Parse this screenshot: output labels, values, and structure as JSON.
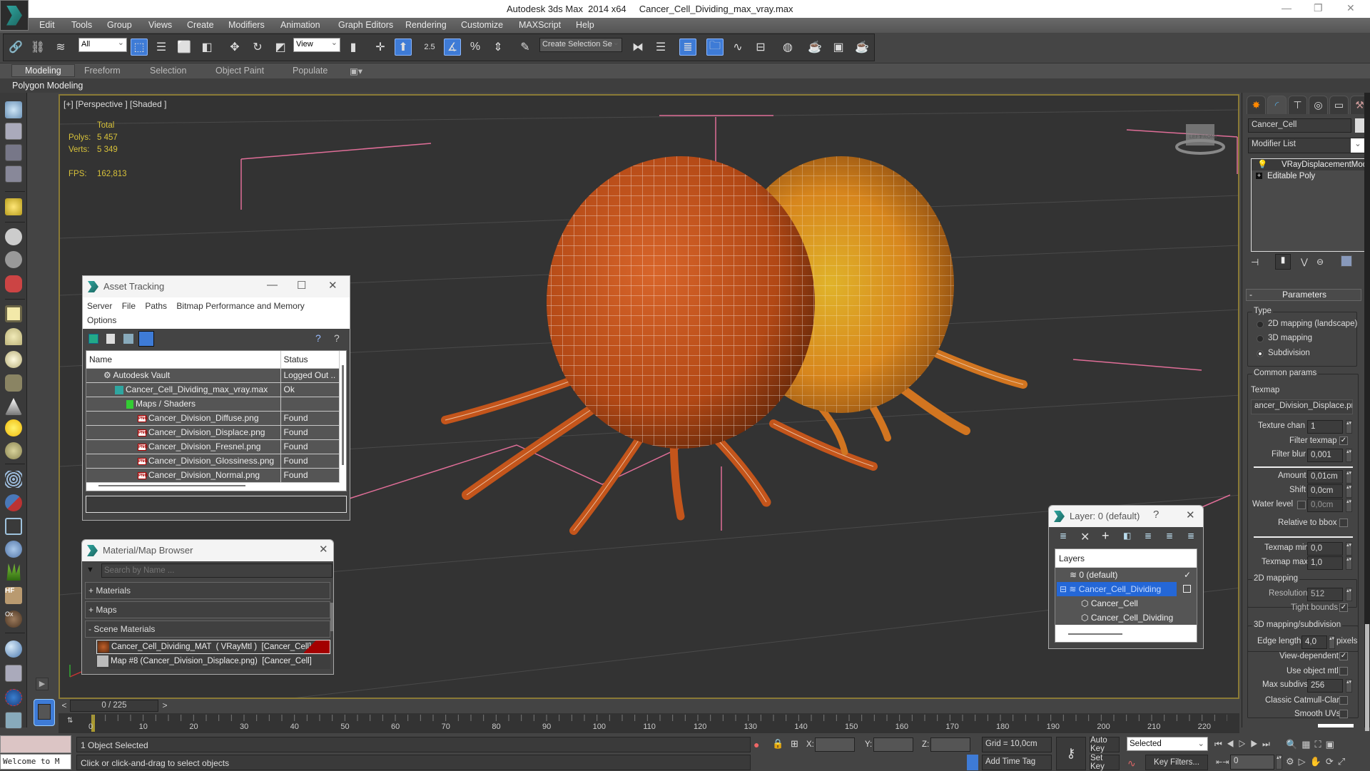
{
  "window": {
    "title": "Autodesk 3ds Max  2014 x64     Cancer_Cell_Dividing_max_vray.max",
    "minimize": "—",
    "maximize": "❐",
    "close": "✕"
  },
  "menu": [
    "Edit",
    "Tools",
    "Group",
    "Views",
    "Create",
    "Modifiers",
    "Animation",
    "Graph Editors",
    "Rendering",
    "Customize",
    "MAXScript",
    "Help"
  ],
  "toolbar": {
    "selection_filter": "All",
    "ref_coord": "View",
    "snap_value": "2.5",
    "named_selection_placeholder": "Create Selection Se"
  },
  "ribbon": {
    "tabs": [
      "Modeling",
      "Freeform",
      "Selection",
      "Object Paint",
      "Populate"
    ],
    "active": "Modeling",
    "subpanel": "Polygon Modeling"
  },
  "viewport": {
    "label": "[+] [Perspective ] [Shaded ]",
    "stats": {
      "header": "Total",
      "polys_label": "Polys:",
      "polys": "5 457",
      "verts_label": "Verts:",
      "verts": "5 349",
      "fps_label": "FPS:",
      "fps": "162,813"
    },
    "viewcube": {
      "left": "LEFT",
      "front": "FRONT"
    }
  },
  "asset_tracking": {
    "title": "Asset Tracking",
    "menu": [
      "Server",
      "File",
      "Paths",
      "Bitmap Performance and Memory",
      "Options"
    ],
    "columns": [
      "Name",
      "Status"
    ],
    "rows": [
      {
        "name": "Autodesk Vault",
        "status": "Logged Out ..",
        "icon": "vault-icon",
        "indent": 1
      },
      {
        "name": "Cancer_Cell_Dividing_max_vray.max",
        "status": "Ok",
        "icon": "max-file-icon",
        "indent": 2
      },
      {
        "name": "Maps / Shaders",
        "status": "",
        "icon": "maps-folder-icon",
        "indent": 3
      },
      {
        "name": "Cancer_Division_Diffuse.png",
        "status": "Found",
        "icon": "png-icon",
        "indent": 4
      },
      {
        "name": "Cancer_Division_Displace.png",
        "status": "Found",
        "icon": "png-icon",
        "indent": 4
      },
      {
        "name": "Cancer_Division_Fresnel.png",
        "status": "Found",
        "icon": "png-icon",
        "indent": 4
      },
      {
        "name": "Cancer_Division_Glossiness.png",
        "status": "Found",
        "icon": "png-icon",
        "indent": 4
      },
      {
        "name": "Cancer_Division_Normal.png",
        "status": "Found",
        "icon": "png-icon",
        "indent": 4
      }
    ],
    "png_glyph": "PNG"
  },
  "material_browser": {
    "title": "Material/Map Browser",
    "search_placeholder": "Search by Name ...",
    "groups": [
      "+ Materials",
      "+ Maps",
      "- Scene Materials"
    ],
    "items": [
      "Cancer_Cell_Dividing_MAT  ( VRayMtl )  [Cancer_Cell]",
      "Map #8 (Cancer_Division_Displace.png)  [Cancer_Cell]"
    ]
  },
  "layer_dialog": {
    "title": "Layer: 0 (default)",
    "help": "?",
    "column": "Layers",
    "rows": [
      {
        "name": "0 (default)",
        "type": "layer",
        "state": "✓"
      },
      {
        "name": "Cancer_Cell_Dividing",
        "type": "layer",
        "state": "",
        "selected": true
      },
      {
        "name": "Cancer_Cell",
        "type": "object"
      },
      {
        "name": "Cancer_Cell_Dividing",
        "type": "object"
      }
    ]
  },
  "command_panel": {
    "object_name": "Cancer_Cell",
    "modifier_list": "Modifier List",
    "stack": [
      "VRayDisplacementMod",
      "Editable Poly"
    ],
    "rollout_title": "Parameters",
    "type_group": "Type",
    "type_options": [
      "2D mapping (landscape)",
      "3D mapping",
      "Subdivision"
    ],
    "type_selected": 2,
    "common_group": "Common params",
    "texmap_label": "Texmap",
    "texmap_value": "ancer_Division_Displace.png)",
    "texture_chan_label": "Texture chan",
    "texture_chan": "1",
    "filter_texmap_label": "Filter texmap",
    "filter_texmap": true,
    "filter_blur_label": "Filter blur",
    "filter_blur": "0,001",
    "amount_label": "Amount",
    "amount": "0,01cm",
    "shift_label": "Shift",
    "shift": "0,0cm",
    "water_level_label": "Water level",
    "water_level": "0,0cm",
    "relative_bbox_label": "Relative to bbox",
    "texmap_min_label": "Texmap min",
    "texmap_min": "0,0",
    "texmap_max_label": "Texmap max",
    "texmap_max": "1,0",
    "mapping2d_group": "2D mapping",
    "resolution_label": "Resolution",
    "resolution": "512",
    "tight_bounds_label": "Tight bounds",
    "tight_bounds": true,
    "mapping3d_group": "3D mapping/subdivision",
    "edge_length_label": "Edge length",
    "edge_length": "4,0",
    "pixels_label": "pixels",
    "view_dependent_label": "View-dependent",
    "view_dependent": true,
    "use_object_mtl_label": "Use object mtl",
    "max_subdivs_label": "Max subdivs",
    "max_subdivs": "256",
    "catmull_label": "Classic Catmull-Clark",
    "smooth_uvs_label": "Smooth UVs"
  },
  "timeline": {
    "frame_display": "0 / 225",
    "prev": "<",
    "next": ">",
    "ticks": [
      "0",
      "10",
      "20",
      "30",
      "40",
      "50",
      "60",
      "70",
      "80",
      "90",
      "100",
      "110",
      "120",
      "130",
      "140",
      "150",
      "160",
      "170",
      "180",
      "190",
      "200",
      "210",
      "220"
    ]
  },
  "status": {
    "maxscript": "Welcome to M",
    "selection": "1 Object Selected",
    "prompt": "Click or click-and-drag to select objects",
    "x_label": "X:",
    "y_label": "Y:",
    "z_label": "Z:",
    "grid": "Grid = 10,0cm",
    "add_time_tag": "Add Time Tag",
    "auto_key": "Auto Key",
    "set_key": "Set Key",
    "key_mode": "Selected",
    "key_filters": "Key Filters...",
    "current_frame": "0"
  }
}
